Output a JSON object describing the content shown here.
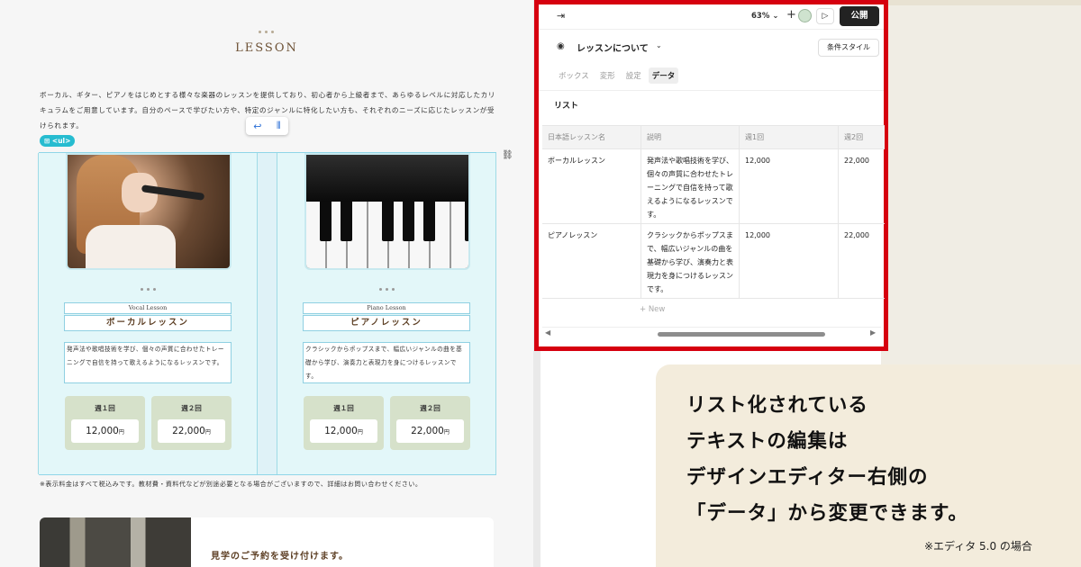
{
  "canvas": {
    "heading": "LESSON",
    "intro": "ボーカル、ギター、ピアノをはじめとする様々な楽器のレッスンを提供しており、初心者から上級者まで、あらゆるレベルに対応したカリキュラムをご用意しています。自分のペースで学びたい方や、特定のジャンルに特化したい方も、それぞれのニーズに応じたレッスンが受けられます。",
    "ul_tag": "<ul>",
    "cards": [
      {
        "sub_en": "Vocal Lesson",
        "name": "ボーカルレッスン",
        "desc": "発声法や歌唱技術を学び、個々の声質に合わせたトレーニングで自信を持って歌えるようになるレッスンです。",
        "prices": [
          {
            "label": "週１回",
            "value": "12,000",
            "unit": "円"
          },
          {
            "label": "週２回",
            "value": "22,000",
            "unit": "円"
          }
        ]
      },
      {
        "sub_en": "Piano Lesson",
        "name": "ピアノレッスン",
        "desc": "クラシックからポップスまで、幅広いジャンルの曲を基礎から学び、演奏力と表現力を身につけるレッスンです。",
        "prices": [
          {
            "label": "週１回",
            "value": "12,000",
            "unit": "円"
          },
          {
            "label": "週２回",
            "value": "22,000",
            "unit": "円"
          }
        ]
      }
    ],
    "footnote": "※表示料金はすべて税込みです。教材費・資料代などが別途必要となる場合がございますので、詳細はお問い合わせください。",
    "bottom_text": "見学のご予約を受け付けます。"
  },
  "editor": {
    "zoom": "63%",
    "publish": "公開",
    "section": "レッスンについて",
    "cond_style": "条件スタイル",
    "tabs": [
      "ボックス",
      "変形",
      "設定",
      "データ"
    ],
    "active_tab": "データ",
    "list_label": "リスト",
    "columns": [
      "日本語レッスン名",
      "説明",
      "週1回",
      "週2回"
    ],
    "rows": [
      [
        "ボーカルレッスン",
        "発声法や歌唱技術を学び、個々の声質に合わせたトレーニングで自信を持って歌えるようになるレッスンです。",
        "12,000",
        "22,000"
      ],
      [
        "ピアノレッスン",
        "クラシックからポップスまで、幅広いジャンルの曲を基礎から学び、演奏力と表現力を身につけるレッスンです。",
        "12,000",
        "22,000"
      ]
    ],
    "new_row": "+ New"
  },
  "callout": {
    "lines": [
      "リスト化されている",
      "テキストの編集は",
      "デザインエディター右側の",
      "「データ」から変更できます。"
    ],
    "note": "※エディタ 5.0 の場合"
  },
  "colors": {
    "highlight_border": "#d6000f",
    "selection": "#8fd6e8",
    "callout_bg": "#f3ecdc"
  }
}
